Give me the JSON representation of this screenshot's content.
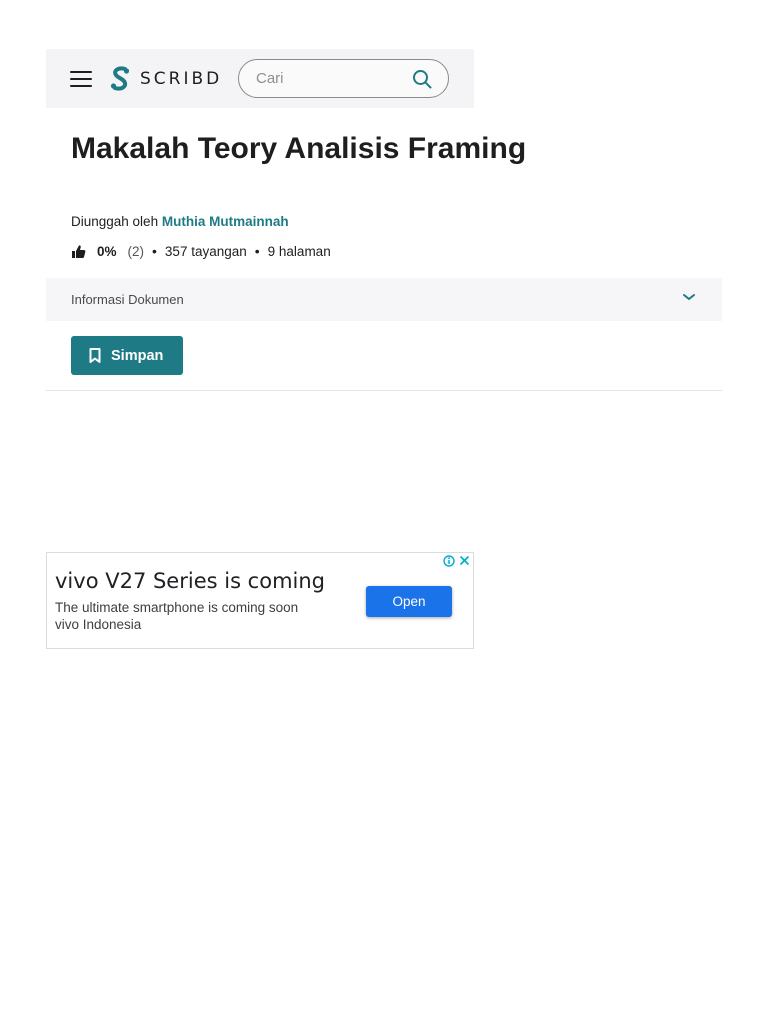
{
  "header": {
    "logo_text": "SCRIBD",
    "search_placeholder": "Cari"
  },
  "document": {
    "title": "Makalah Teory Analisis Framing",
    "uploaded_by_label": "Diunggah oleh",
    "uploader_name": "Muthia Mutmainnah",
    "rating_percent": "0%",
    "rating_count": "(2)",
    "views": "357 tayangan",
    "pages": "9 halaman",
    "info_label": "Informasi Dokumen",
    "save_label": "Simpan"
  },
  "ad": {
    "headline": "vivo V27 Series is coming",
    "description": "The ultimate smartphone is coming soon",
    "advertiser": "vivo Indonesia",
    "cta_label": "Open"
  },
  "colors": {
    "brand_teal": "#1e7b85",
    "ad_button_blue": "#1a73e8",
    "header_bg": "#f4f4f6"
  }
}
